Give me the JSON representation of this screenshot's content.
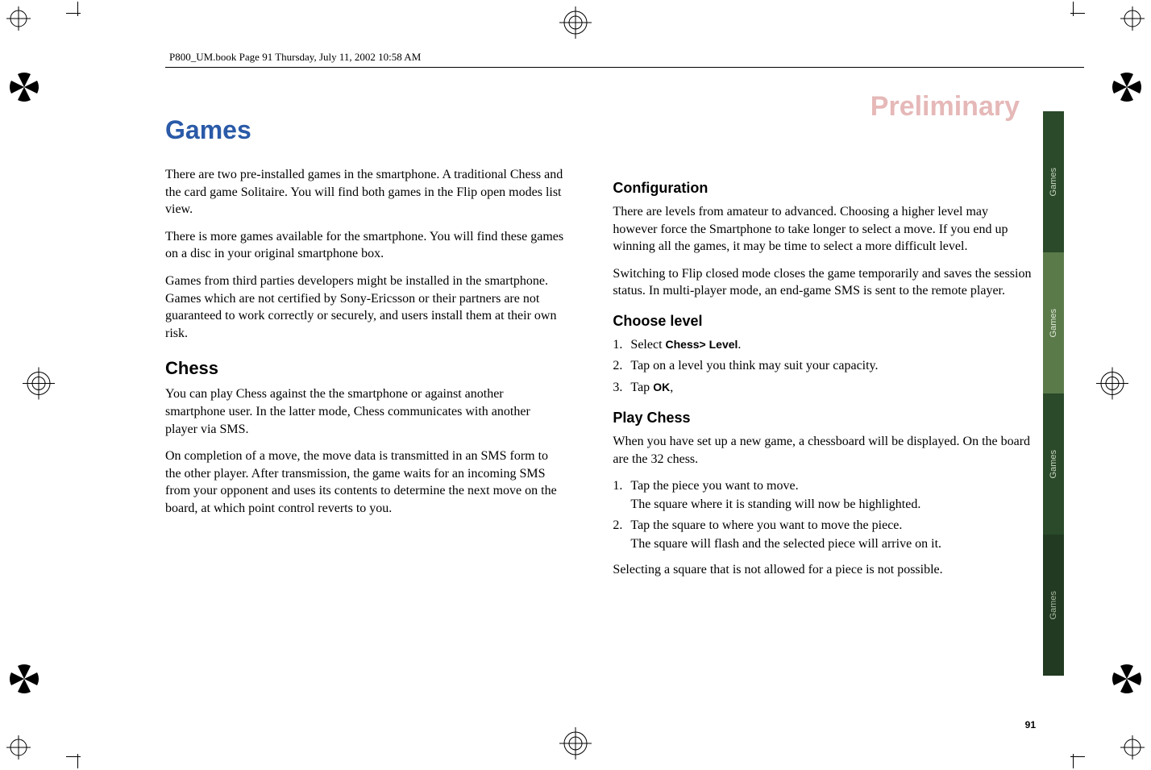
{
  "header": "P800_UM.book  Page 91  Thursday, July 11, 2002  10:58 AM",
  "watermark": "Preliminary",
  "page_number": "91",
  "tabs": [
    "Games",
    "Games",
    "Games",
    "Games"
  ],
  "left": {
    "title": "Games",
    "p1": "There are two pre-installed games in the smartphone. A traditional Chess and the card game Solitaire. You will find both games in the Flip open modes list view.",
    "p2": "There is more games available for the smartphone. You will find these games on a disc in your original smartphone box.",
    "p3": "Games from third parties developers might be installed in the smartphone. Games which are not certified by Sony-Ericsson or their partners are not guaranteed to work correctly or securely, and users install them at their own risk.",
    "h2_chess": "Chess",
    "p4": "You can play Chess against the the smartphone or against another smartphone user. In the latter mode, Chess communicates with another player via SMS.",
    "p5": "On completion of a move, the move data is transmitted in an SMS form to the other player. After transmission, the game waits for an incoming SMS from your opponent and uses its contents to determine the next move on the board, at which point control reverts to you."
  },
  "right": {
    "h3_config": "Configuration",
    "p6": "There are levels from amateur to advanced. Choosing a higher level may however force the Smartphone to take longer to select a move. If you end up winning all the games, it may be time to select a more difficult level.",
    "p7": "Switching to Flip closed mode closes the game temporarily and saves the session status. In multi-player mode, an end-game SMS is sent to the remote player.",
    "h3_level": "Choose level",
    "ol1": {
      "i1a": "Select ",
      "i1b": "Chess> Level",
      "i1c": ".",
      "i2": "Tap on a level you think may suit your capacity.",
      "i3a": "Tap ",
      "i3b": "OK",
      "i3c": ","
    },
    "h3_play": "Play Chess",
    "p8": "When you have set up a new game, a chessboard will be displayed. On the board are the 32 chess.",
    "ol2": {
      "i1a": "Tap the piece you want to move.",
      "i1b": "The square where it is standing will now be highlighted.",
      "i2a": "Tap the square to where you want to move the piece.",
      "i2b": "The square will flash and the selected piece will arrive on it."
    },
    "p9": "Selecting a square that is not allowed for a piece is not possible."
  }
}
